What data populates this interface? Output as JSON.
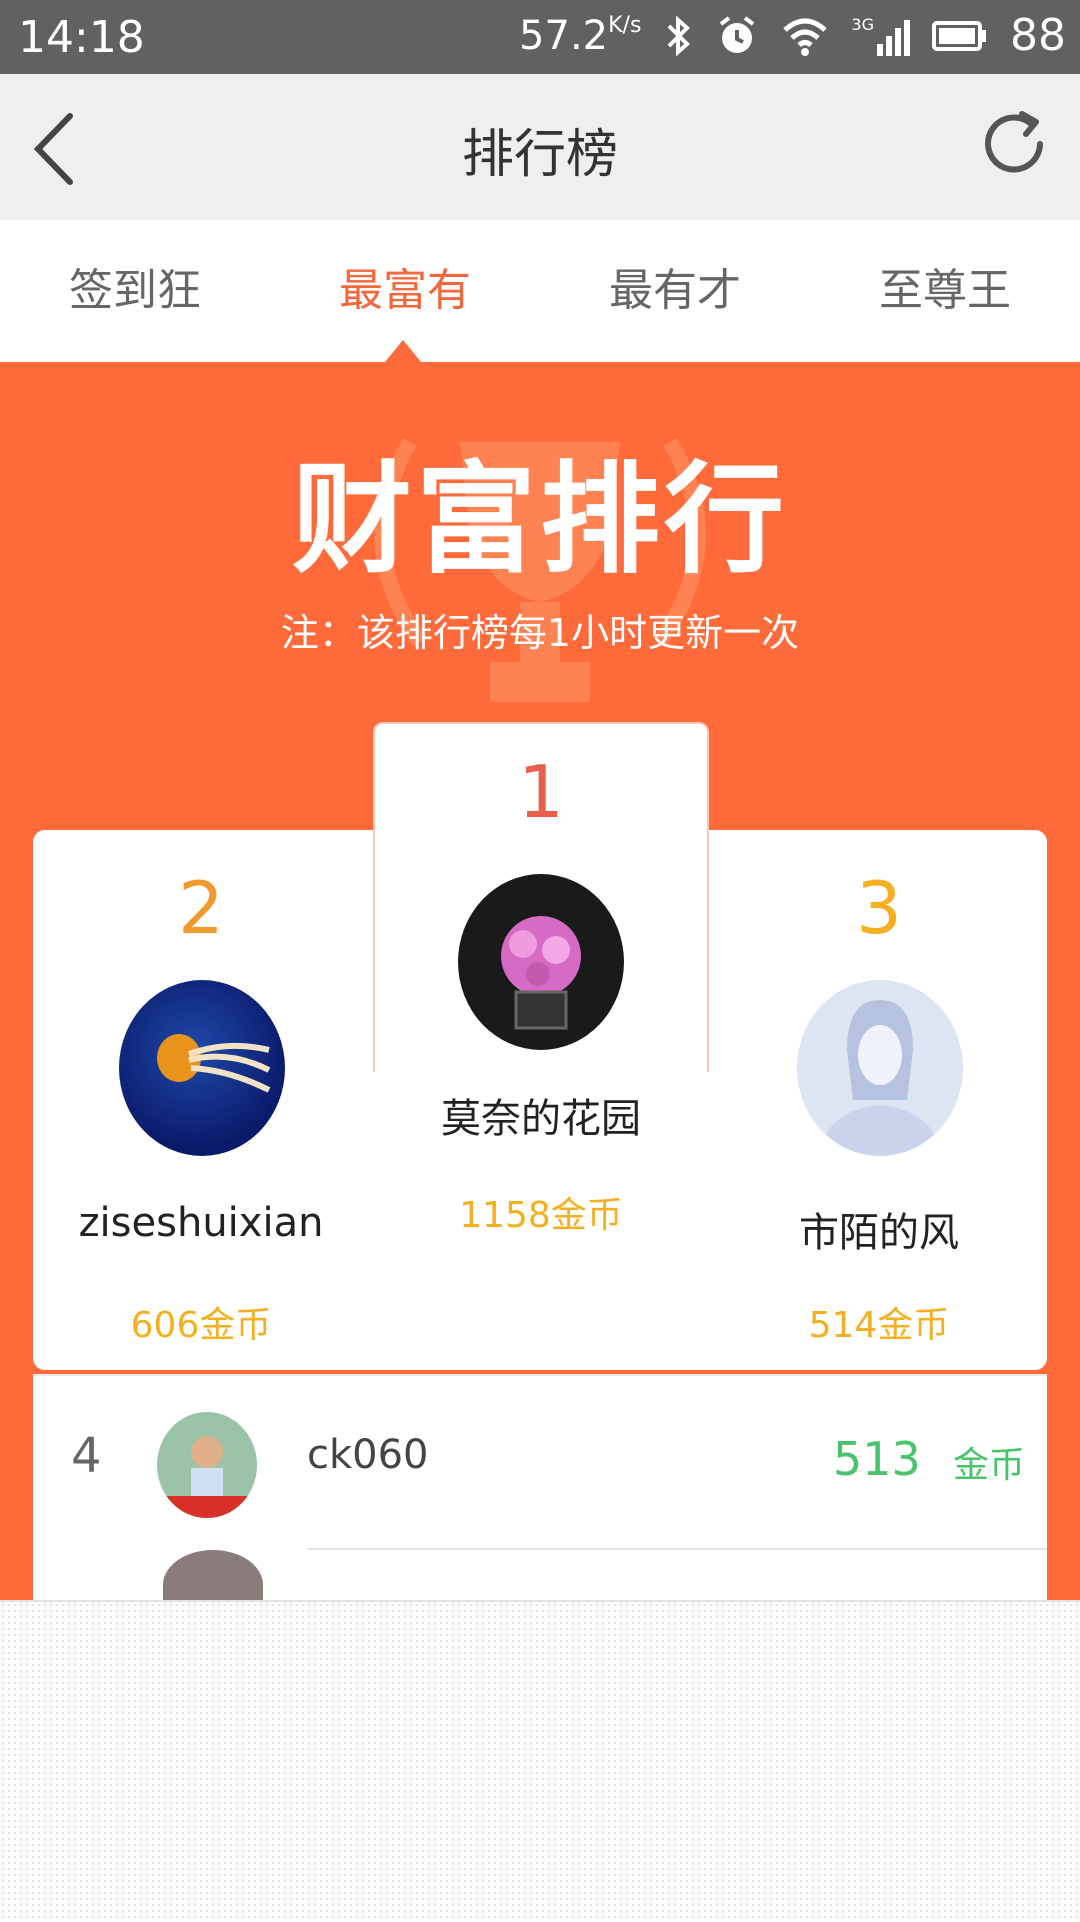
{
  "status_bar": {
    "time": "14:18",
    "speed": "57.2",
    "speed_unit": "K/s",
    "network": "3G",
    "battery": "88"
  },
  "app_bar": {
    "title": "排行榜",
    "back_icon": "chevron-left-icon",
    "refresh_icon": "refresh-icon"
  },
  "tabs": [
    {
      "label": "签到狂",
      "active": false
    },
    {
      "label": "最富有",
      "active": true
    },
    {
      "label": "最有才",
      "active": false
    },
    {
      "label": "至尊王",
      "active": false
    }
  ],
  "banner": {
    "title": "财富排行",
    "note": "注：该排行榜每1小时更新一次",
    "color": "#ff6a3a"
  },
  "podium": [
    {
      "rank": "1",
      "name": "莫奈的花园",
      "coins": "1158金币",
      "rank_color": "#e8604b"
    },
    {
      "rank": "2",
      "name": "ziseshuixian",
      "coins": "606金币",
      "rank_color": "#f39a2e"
    },
    {
      "rank": "3",
      "name": "市陌的风",
      "coins": "514金币",
      "rank_color": "#f5b021"
    }
  ],
  "list": [
    {
      "rank": "4",
      "name": "ck060",
      "value": "513",
      "unit": "金币"
    }
  ],
  "colors": {
    "accent": "#f0683c",
    "coin_gold": "#f5b021",
    "coin_green": "#49c46c"
  }
}
